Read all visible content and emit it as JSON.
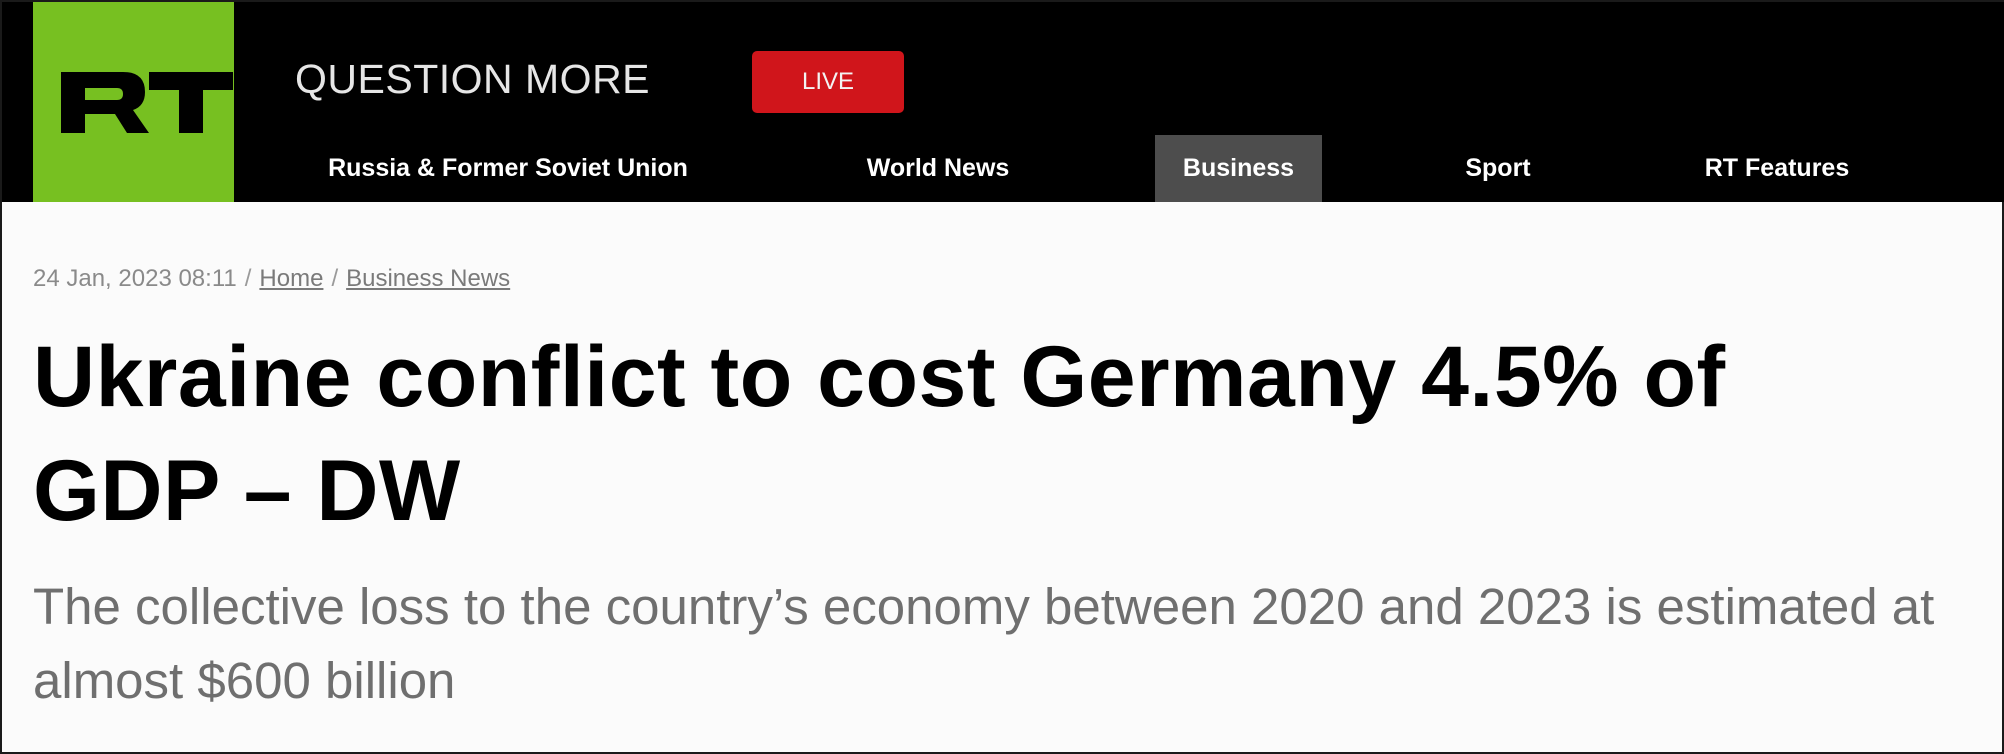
{
  "header": {
    "logo_text": "RT",
    "tagline": "QUESTION MORE",
    "live_label": "LIVE"
  },
  "nav": {
    "items": [
      {
        "label": "Russia & Former Soviet Union"
      },
      {
        "label": "World News"
      },
      {
        "label": "Business",
        "active": true
      },
      {
        "label": "Sport"
      },
      {
        "label": "RT Features"
      }
    ]
  },
  "article": {
    "timestamp": "24 Jan, 2023 08:11",
    "breadcrumb": [
      {
        "label": "Home"
      },
      {
        "label": "Business News"
      }
    ],
    "headline": "Ukraine conflict to cost Germany 4.5% of GDP – DW",
    "summary": "The collective loss to the country’s economy between 2020 and 2023 is estimated at almost $600 billion"
  },
  "colors": {
    "brand_green": "#77c021",
    "live_red": "#d0151b",
    "nav_active_bg": "#4d4d4d"
  }
}
